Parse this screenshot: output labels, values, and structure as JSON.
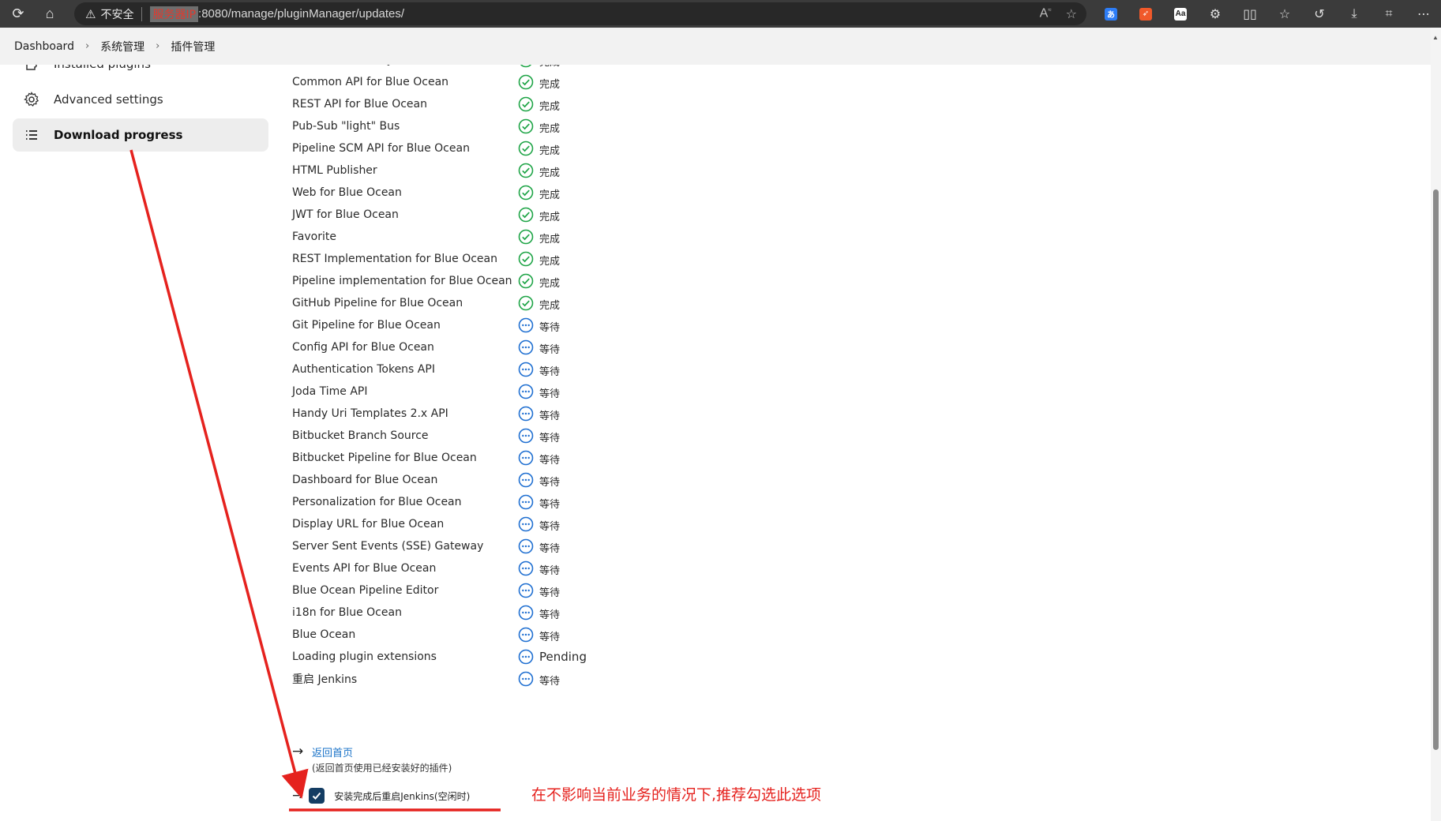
{
  "browser": {
    "security_label": "不安全",
    "host_redacted": "服务器IP",
    "url_path": ":8080/manage/pluginManager/updates/"
  },
  "breadcrumb": [
    "Dashboard",
    "系统管理",
    "插件管理"
  ],
  "sidebar": {
    "items": [
      {
        "label": "Installed plugins",
        "icon": "puzzle-icon",
        "active": false
      },
      {
        "label": "Advanced settings",
        "icon": "gear-icon",
        "active": false
      },
      {
        "label": "Download progress",
        "icon": "list-icon",
        "active": true
      }
    ]
  },
  "plugins": [
    {
      "name": "Blue Ocean Core JS",
      "status": "完成",
      "state": "done"
    },
    {
      "name": "Common API for Blue Ocean",
      "status": "完成",
      "state": "done"
    },
    {
      "name": "REST API for Blue Ocean",
      "status": "完成",
      "state": "done"
    },
    {
      "name": "Pub-Sub \"light\" Bus",
      "status": "完成",
      "state": "done"
    },
    {
      "name": "Pipeline SCM API for Blue Ocean",
      "status": "完成",
      "state": "done"
    },
    {
      "name": "HTML Publisher",
      "status": "完成",
      "state": "done"
    },
    {
      "name": "Web for Blue Ocean",
      "status": "完成",
      "state": "done"
    },
    {
      "name": "JWT for Blue Ocean",
      "status": "完成",
      "state": "done"
    },
    {
      "name": "Favorite",
      "status": "完成",
      "state": "done"
    },
    {
      "name": "REST Implementation for Blue Ocean",
      "status": "完成",
      "state": "done"
    },
    {
      "name": "Pipeline implementation for Blue Ocean",
      "status": "完成",
      "state": "done"
    },
    {
      "name": "GitHub Pipeline for Blue Ocean",
      "status": "完成",
      "state": "done"
    },
    {
      "name": "Git Pipeline for Blue Ocean",
      "status": "等待",
      "state": "waiting"
    },
    {
      "name": "Config API for Blue Ocean",
      "status": "等待",
      "state": "waiting"
    },
    {
      "name": "Authentication Tokens API",
      "status": "等待",
      "state": "waiting"
    },
    {
      "name": "Joda Time API",
      "status": "等待",
      "state": "waiting"
    },
    {
      "name": "Handy Uri Templates 2.x API",
      "status": "等待",
      "state": "waiting"
    },
    {
      "name": "Bitbucket Branch Source",
      "status": "等待",
      "state": "waiting"
    },
    {
      "name": "Bitbucket Pipeline for Blue Ocean",
      "status": "等待",
      "state": "waiting"
    },
    {
      "name": "Dashboard for Blue Ocean",
      "status": "等待",
      "state": "waiting"
    },
    {
      "name": "Personalization for Blue Ocean",
      "status": "等待",
      "state": "waiting"
    },
    {
      "name": "Display URL for Blue Ocean",
      "status": "等待",
      "state": "waiting"
    },
    {
      "name": "Server Sent Events (SSE) Gateway",
      "status": "等待",
      "state": "waiting"
    },
    {
      "name": "Events API for Blue Ocean",
      "status": "等待",
      "state": "waiting"
    },
    {
      "name": "Blue Ocean Pipeline Editor",
      "status": "等待",
      "state": "waiting"
    },
    {
      "name": "i18n for Blue Ocean",
      "status": "等待",
      "state": "waiting"
    },
    {
      "name": "Blue Ocean",
      "status": "等待",
      "state": "waiting"
    },
    {
      "name": "Loading plugin extensions",
      "status": "Pending",
      "state": "waiting"
    },
    {
      "name": "重启 Jenkins",
      "status": "等待",
      "state": "waiting"
    }
  ],
  "footer": {
    "back_link": "返回首页",
    "back_hint": "(返回首页使用已经安装好的插件)",
    "restart_label": "安装完成后重启Jenkins(空闲时)",
    "restart_checked": true
  },
  "annotation": {
    "text": "在不影响当前业务的情况下,推荐勾选此选项",
    "color": "#e5221e"
  },
  "colors": {
    "done": "#1ea446",
    "waiting": "#1f6fd1"
  }
}
